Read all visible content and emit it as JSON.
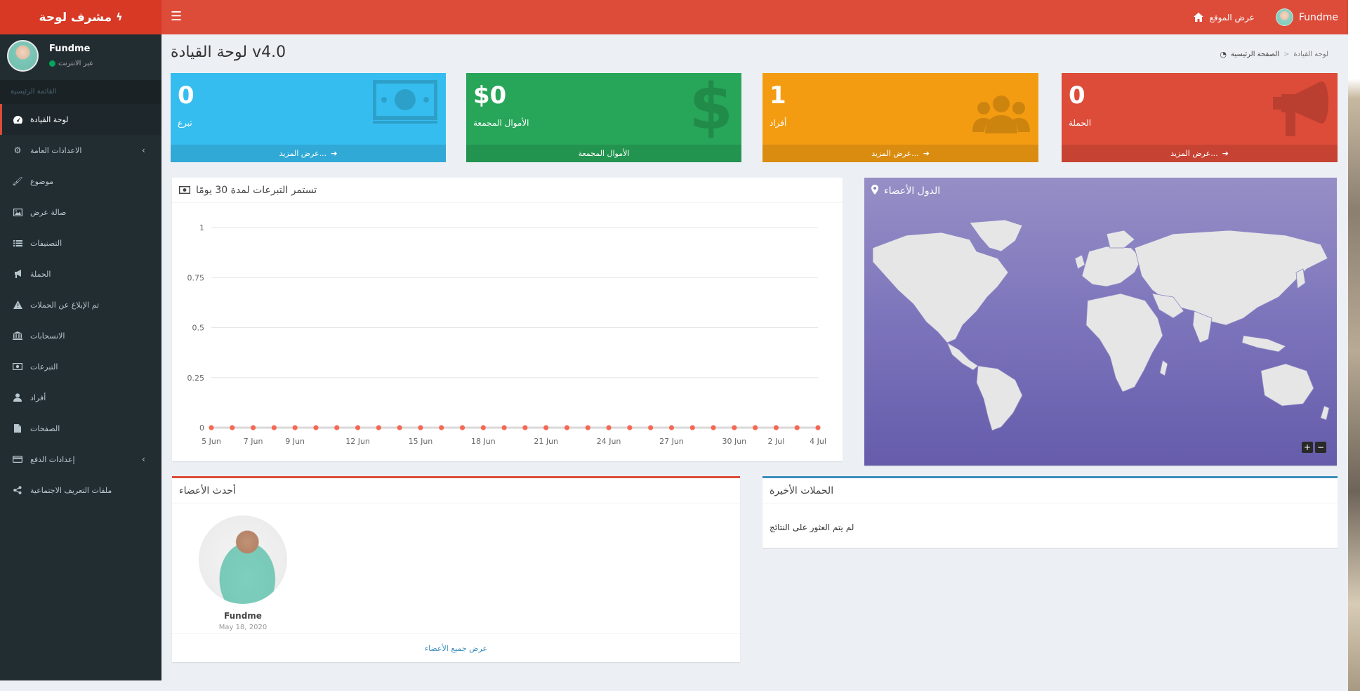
{
  "brand": {
    "title": "مشرف لوحة"
  },
  "topbar": {
    "view_site": "عرض الموقع",
    "user_name": "Fundme"
  },
  "sidebar": {
    "user": {
      "name": "Fundme",
      "status": "عبر الانترنت"
    },
    "header": "القائمة الرئيسية",
    "items": [
      {
        "label": "لوحة القيادة",
        "icon": "dashboard-icon"
      },
      {
        "label": "الاعدادات العامة",
        "icon": "gears-icon"
      },
      {
        "label": "موضوع",
        "icon": "paint-brush-icon"
      },
      {
        "label": "صالة عرض",
        "icon": "image-icon"
      },
      {
        "label": "التصنيفات",
        "icon": "list-icon"
      },
      {
        "label": "الحملة",
        "icon": "bullhorn-icon"
      },
      {
        "label": "تم الإبلاغ عن الحملات",
        "icon": "warning-icon"
      },
      {
        "label": "الانسحابات",
        "icon": "bank-icon"
      },
      {
        "label": "التبرعات",
        "icon": "money-icon"
      },
      {
        "label": "أفراد",
        "icon": "user-icon"
      },
      {
        "label": "الصفحات",
        "icon": "file-icon"
      },
      {
        "label": "إعدادات الدفع",
        "icon": "credit-card-icon"
      },
      {
        "label": "ملفات التعريف الاجتماعية",
        "icon": "share-icon"
      }
    ]
  },
  "content": {
    "title": "لوحة القيادة v4.0",
    "breadcrumb": {
      "home": "الصفحة الرئيسية",
      "current": "لوحة القيادة"
    }
  },
  "stats": [
    {
      "value": "0",
      "label": "تبرع",
      "footer": "عرض المزيد...",
      "color": "#36bdef",
      "icon": "money-bill-icon"
    },
    {
      "value": "$0",
      "label": "الأموال المجمعة",
      "footer": "الأموال المجمعة",
      "color": "#27a558",
      "icon": "dollar-icon"
    },
    {
      "value": "1",
      "label": "أفراد",
      "footer": "عرض المزيد...",
      "color": "#f39c12",
      "icon": "users-icon"
    },
    {
      "value": "0",
      "label": "الحملة",
      "footer": "عرض المزيد...",
      "color": "#dd4b39",
      "icon": "bullhorn-icon"
    }
  ],
  "donations_chart": {
    "title": "تستمر التبرعات لمدة 30 يومًا"
  },
  "chart_data": {
    "type": "line",
    "title": "تستمر التبرعات لمدة 30 يومًا",
    "xlabel": "",
    "ylabel": "",
    "ylim": [
      0,
      1
    ],
    "yticks": [
      "0",
      "0.25",
      "0.5",
      "0.75",
      "1"
    ],
    "x": [
      "5 Jun",
      "6 Jun",
      "7 Jun",
      "8 Jun",
      "9 Jun",
      "10 Jun",
      "11 Jun",
      "12 Jun",
      "13 Jun",
      "14 Jun",
      "15 Jun",
      "16 Jun",
      "17 Jun",
      "18 Jun",
      "19 Jun",
      "20 Jun",
      "21 Jun",
      "22 Jun",
      "23 Jun",
      "24 Jun",
      "25 Jun",
      "26 Jun",
      "27 Jun",
      "28 Jun",
      "29 Jun",
      "30 Jun",
      "1 Jul",
      "2 Jul",
      "3 Jul",
      "4 Jul"
    ],
    "xticks": [
      "5 Jun",
      "7 Jun",
      "9 Jun",
      "12 Jun",
      "15 Jun",
      "18 Jun",
      "21 Jun",
      "24 Jun",
      "27 Jun",
      "30 Jun",
      "2 Jul",
      "4 Jul"
    ],
    "series": [
      {
        "values": [
          0,
          0,
          0,
          0,
          0,
          0,
          0,
          0,
          0,
          0,
          0,
          0,
          0,
          0,
          0,
          0,
          0,
          0,
          0,
          0,
          0,
          0,
          0,
          0,
          0,
          0,
          0,
          0,
          0,
          0
        ],
        "color": "#f56954"
      }
    ],
    "grid": true
  },
  "map": {
    "title": "الدول الأعضاء",
    "zoom_in": "+",
    "zoom_out": "−"
  },
  "members": {
    "title": "أحدث الأعضاء",
    "list": [
      {
        "name": "Fundme",
        "date": "May 18, 2020"
      }
    ],
    "view_all": "عرض جميع الأعضاء"
  },
  "campaigns": {
    "title": "الحملات الأخيرة",
    "empty": "لم يتم العثور على النتائج"
  }
}
